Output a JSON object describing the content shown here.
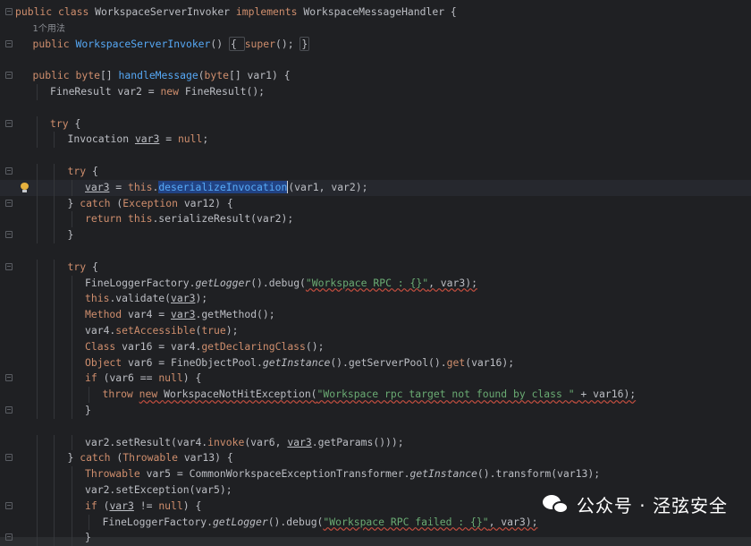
{
  "editor": {
    "usage_hint": "1个用法",
    "lines": [
      {
        "indent": 0,
        "fold": true,
        "segments": [
          [
            "kw",
            "public "
          ],
          [
            "kw",
            "class "
          ],
          [
            "cls",
            "WorkspaceServerInvoker "
          ],
          [
            "kw",
            "implements "
          ],
          [
            "cls",
            "WorkspaceMessageHandler {"
          ]
        ]
      },
      {
        "indent": 1,
        "hint": true
      },
      {
        "indent": 1,
        "fold": true,
        "segments": [
          [
            "kw",
            "public "
          ],
          [
            "fn",
            "WorkspaceServerInvoker"
          ],
          [
            "cls",
            "() "
          ],
          [
            "box",
            "{ "
          ],
          [
            "kw",
            "super"
          ],
          [
            "cls",
            "(); "
          ],
          [
            "box",
            "}"
          ]
        ]
      },
      {
        "indent": 0,
        "segments": []
      },
      {
        "indent": 1,
        "fold": true,
        "segments": [
          [
            "kw",
            "public "
          ],
          [
            "kw",
            "byte"
          ],
          [
            "cls",
            "[] "
          ],
          [
            "fn",
            "handleMessage"
          ],
          [
            "cls",
            "("
          ],
          [
            "kw",
            "byte"
          ],
          [
            "cls",
            "[] var1) {"
          ]
        ]
      },
      {
        "indent": 2,
        "segments": [
          [
            "cls",
            "FineResult var2 = "
          ],
          [
            "kw",
            "new "
          ],
          [
            "cls",
            "FineResult();"
          ]
        ]
      },
      {
        "indent": 0,
        "segments": []
      },
      {
        "indent": 2,
        "fold": true,
        "segments": [
          [
            "kw",
            "try "
          ],
          [
            "cls",
            "{"
          ]
        ]
      },
      {
        "indent": 3,
        "segments": [
          [
            "cls",
            "Invocation "
          ],
          [
            "ul",
            "var3"
          ],
          [
            "cls",
            " = "
          ],
          [
            "kw",
            "null"
          ],
          [
            "cls",
            ";"
          ]
        ]
      },
      {
        "indent": 0,
        "segments": []
      },
      {
        "indent": 3,
        "fold": true,
        "segments": [
          [
            "kw",
            "try "
          ],
          [
            "cls",
            "{"
          ]
        ]
      },
      {
        "indent": 4,
        "caret": true,
        "bulb": true,
        "segments": [
          [
            "ul",
            "var3"
          ],
          [
            "cls",
            " = "
          ],
          [
            "kw",
            "this"
          ],
          [
            "cls",
            "."
          ],
          [
            "hl",
            "deserializeInvocation"
          ],
          [
            "caret",
            ""
          ],
          [
            "cls",
            "(var1, var2);"
          ]
        ]
      },
      {
        "indent": 3,
        "fold": true,
        "segments": [
          [
            "cls",
            "} "
          ],
          [
            "kw",
            "catch "
          ],
          [
            "cls",
            "("
          ],
          [
            "ty",
            "Exception "
          ],
          [
            "cls",
            "var12) {"
          ]
        ]
      },
      {
        "indent": 4,
        "segments": [
          [
            "kw",
            "return "
          ],
          [
            "kw",
            "this"
          ],
          [
            "cls",
            ".serializeResult(var2);"
          ]
        ]
      },
      {
        "indent": 3,
        "fold": true,
        "segments": [
          [
            "cls",
            "}"
          ]
        ]
      },
      {
        "indent": 0,
        "segments": []
      },
      {
        "indent": 3,
        "fold": true,
        "segments": [
          [
            "kw",
            "try "
          ],
          [
            "cls",
            "{"
          ]
        ]
      },
      {
        "indent": 4,
        "segments": [
          [
            "cls",
            "FineLoggerFactory."
          ],
          [
            "it",
            "getLogger"
          ],
          [
            "cls",
            "().debug("
          ],
          [
            "strw",
            "\"Workspace RPC : {}\""
          ],
          [
            "wv",
            ", var3);"
          ]
        ]
      },
      {
        "indent": 4,
        "segments": [
          [
            "kw",
            "this"
          ],
          [
            "cls",
            ".validate("
          ],
          [
            "ul",
            "var3"
          ],
          [
            "cls",
            ");"
          ]
        ]
      },
      {
        "indent": 4,
        "segments": [
          [
            "ty",
            "Method "
          ],
          [
            "cls",
            "var4 = "
          ],
          [
            "ul",
            "var3"
          ],
          [
            "cls",
            ".getMethod();"
          ]
        ]
      },
      {
        "indent": 4,
        "segments": [
          [
            "cls",
            "var4."
          ],
          [
            "ty",
            "setAccessible"
          ],
          [
            "cls",
            "("
          ],
          [
            "kw",
            "true"
          ],
          [
            "cls",
            ");"
          ]
        ]
      },
      {
        "indent": 4,
        "segments": [
          [
            "ty",
            "Class "
          ],
          [
            "cls",
            "var16 = var4."
          ],
          [
            "ty",
            "getDeclaringClass"
          ],
          [
            "cls",
            "();"
          ]
        ]
      },
      {
        "indent": 4,
        "segments": [
          [
            "ty",
            "Object "
          ],
          [
            "cls",
            "var6 = FineObjectPool."
          ],
          [
            "it",
            "getInstance"
          ],
          [
            "cls",
            "().getServerPool()."
          ],
          [
            "ty",
            "get"
          ],
          [
            "cls",
            "(var16);"
          ]
        ]
      },
      {
        "indent": 4,
        "fold": true,
        "segments": [
          [
            "kw",
            "if "
          ],
          [
            "cls",
            "(var6 == "
          ],
          [
            "kw",
            "null"
          ],
          [
            "cls",
            ") {"
          ]
        ]
      },
      {
        "indent": 5,
        "segments": [
          [
            "kw",
            "throw "
          ],
          [
            "kwu",
            "new "
          ],
          [
            "wvc",
            "WorkspaceNotHitException("
          ],
          [
            "strw",
            "\"Workspace rpc target not found by class \""
          ],
          [
            "wv",
            " + var16);"
          ]
        ]
      },
      {
        "indent": 4,
        "fold": true,
        "segments": [
          [
            "cls",
            "}"
          ]
        ]
      },
      {
        "indent": 0,
        "segments": []
      },
      {
        "indent": 4,
        "segments": [
          [
            "cls",
            "var2.setResult(var4."
          ],
          [
            "ty",
            "invoke"
          ],
          [
            "cls",
            "(var6, "
          ],
          [
            "ul",
            "var3"
          ],
          [
            "cls",
            ".getParams()));"
          ]
        ]
      },
      {
        "indent": 3,
        "fold": true,
        "segments": [
          [
            "cls",
            "} "
          ],
          [
            "kw",
            "catch "
          ],
          [
            "cls",
            "("
          ],
          [
            "ty",
            "Throwable "
          ],
          [
            "cls",
            "var13) {"
          ]
        ]
      },
      {
        "indent": 4,
        "segments": [
          [
            "ty",
            "Throwable "
          ],
          [
            "cls",
            "var5 = CommonWorkspaceExceptionTransformer."
          ],
          [
            "it",
            "getInstance"
          ],
          [
            "cls",
            "().transform(var13);"
          ]
        ]
      },
      {
        "indent": 4,
        "segments": [
          [
            "cls",
            "var2.setException(var5);"
          ]
        ]
      },
      {
        "indent": 4,
        "fold": true,
        "segments": [
          [
            "kw",
            "if "
          ],
          [
            "cls",
            "("
          ],
          [
            "ul",
            "var3"
          ],
          [
            "cls",
            " != "
          ],
          [
            "kw",
            "null"
          ],
          [
            "cls",
            ") {"
          ]
        ]
      },
      {
        "indent": 5,
        "segments": [
          [
            "cls",
            "FineLoggerFactory."
          ],
          [
            "it",
            "getLogger"
          ],
          [
            "cls",
            "().debug("
          ],
          [
            "strw",
            "\"Workspace RPC failed : {}\""
          ],
          [
            "wv",
            ", var3);"
          ]
        ]
      },
      {
        "indent": 4,
        "fold": true,
        "segments": [
          [
            "cls",
            "}"
          ]
        ]
      }
    ]
  },
  "watermark": {
    "text": "公众号 · 泾弦安全"
  },
  "colors": {
    "background": "#1f2023",
    "keyword": "#cf8e6d",
    "function": "#56a8f5",
    "string": "#6aab73",
    "text": "#bcbec4",
    "selection": "#214283",
    "bulb": "#e6b13e"
  }
}
